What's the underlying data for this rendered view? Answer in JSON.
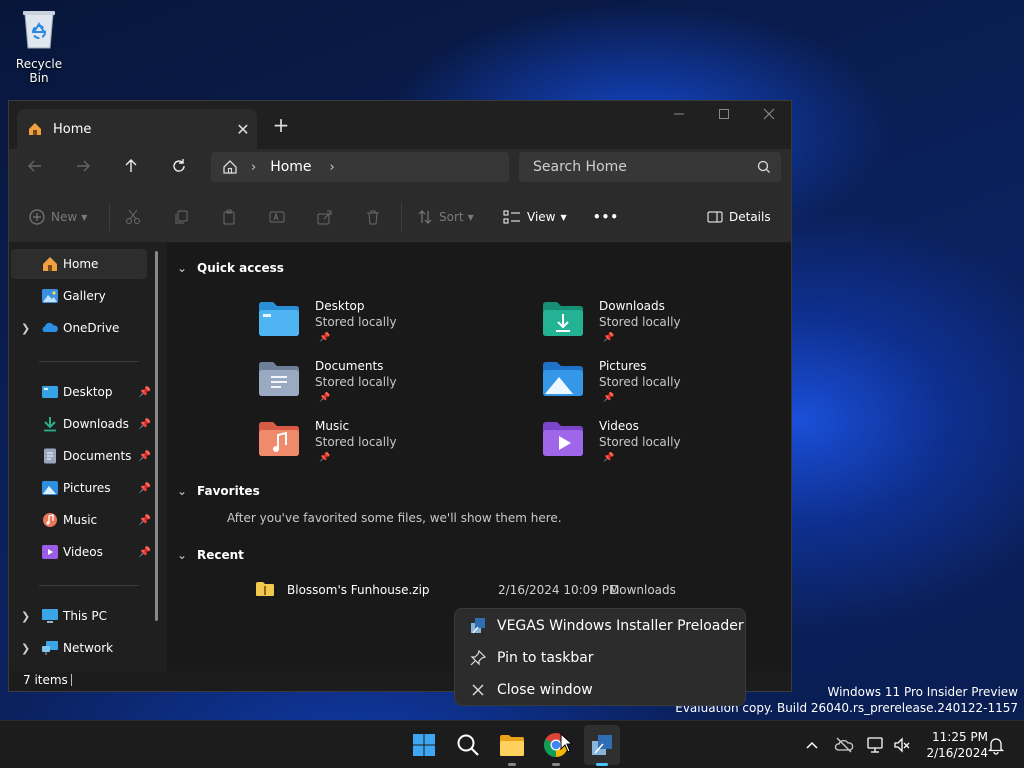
{
  "desktop": {
    "recycle_bin_label": "Recycle Bin",
    "watermark_line1": "Windows 11 Pro Insider Preview",
    "watermark_line2": "Evaluation copy. Build 26040.rs_prerelease.240122-1157"
  },
  "explorer": {
    "tab_title": "Home",
    "tab_close": "✕",
    "new_tab": "+",
    "address": {
      "crumb": "Home",
      "separator": "›"
    },
    "search_placeholder": "Search Home",
    "commands": {
      "new_label": "New",
      "sort_label": "Sort",
      "view_label": "View",
      "more_label": "•••",
      "details_label": "Details"
    },
    "sidebar": {
      "items": [
        {
          "label": "Home",
          "icon": "home-icon"
        },
        {
          "label": "Gallery",
          "icon": "gallery-icon"
        },
        {
          "label": "OneDrive",
          "icon": "onedrive-icon"
        },
        {
          "label": "Desktop",
          "icon": "desktop-folder-icon"
        },
        {
          "label": "Downloads",
          "icon": "downloads-icon"
        },
        {
          "label": "Documents",
          "icon": "documents-icon"
        },
        {
          "label": "Pictures",
          "icon": "pictures-icon"
        },
        {
          "label": "Music",
          "icon": "music-icon"
        },
        {
          "label": "Videos",
          "icon": "videos-icon"
        },
        {
          "label": "This PC",
          "icon": "this-pc-icon"
        },
        {
          "label": "Network",
          "icon": "network-icon"
        }
      ]
    },
    "sections": {
      "quick_access": "Quick access",
      "favorites": "Favorites",
      "recent": "Recent"
    },
    "quick_access": [
      {
        "name": "Desktop",
        "status": "Stored locally",
        "color": "#3aa0e8"
      },
      {
        "name": "Downloads",
        "status": "Stored locally",
        "color": "#1fa88a"
      },
      {
        "name": "Documents",
        "status": "Stored locally",
        "color": "#8a9bb5"
      },
      {
        "name": "Pictures",
        "status": "Stored locally",
        "color": "#2f8fe0"
      },
      {
        "name": "Music",
        "status": "Stored locally",
        "color": "#e8775a"
      },
      {
        "name": "Videos",
        "status": "Stored locally",
        "color": "#9b5de5"
      }
    ],
    "favorites_empty": "After you've favorited some files, we'll show them here.",
    "recent": [
      {
        "name": "Blossom's Funhouse.zip",
        "date": "2/16/2024 10:09 PM",
        "location": "Downloads"
      }
    ],
    "status": {
      "item_count": "7 items"
    }
  },
  "jumplist": {
    "items": [
      {
        "label": "VEGAS Windows Installer Preloader",
        "icon": "installer-icon"
      },
      {
        "label": "Pin to taskbar",
        "icon": "pin-icon"
      },
      {
        "label": "Close window",
        "icon": "close-icon"
      }
    ]
  },
  "taskbar": {
    "time": "11:25 PM",
    "date": "2/16/2024"
  }
}
